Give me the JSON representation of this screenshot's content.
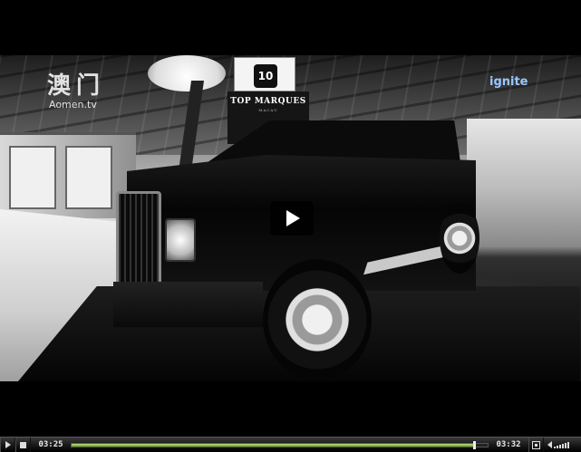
{
  "player": {
    "watermark_cn": "澳门",
    "watermark_en": "Aomen.tv",
    "corner_logo": "ignite",
    "sign_number": "10",
    "sign_title": "TOP MARQUES",
    "sign_subtitle": "MACAU",
    "play_icon": "play-icon"
  },
  "controls": {
    "play_icon": "play-icon",
    "stop_icon": "stop-icon",
    "elapsed": "03:25",
    "duration": "03:32",
    "progress": 0.967,
    "fullscreen_icon": "fullscreen-icon",
    "volume_icon": "volume-icon"
  },
  "colors": {
    "progress_fill": "#8fbf45",
    "accent_logo": "#9ac8ff"
  }
}
